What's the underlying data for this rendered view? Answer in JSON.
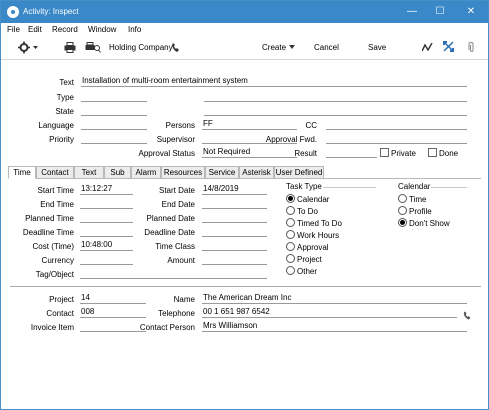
{
  "window": {
    "title": "Activity: Inspect",
    "minimize": "—",
    "maximize": "☐",
    "close": "✕"
  },
  "menu": [
    "File",
    "Edit",
    "Record",
    "Window",
    "Info"
  ],
  "toolbar": {
    "company": "Holding Company",
    "create": "Create",
    "cancel": "Cancel",
    "save": "Save"
  },
  "header": {
    "text_label": "Text",
    "text_value": "Installation of multi-room entertainment system",
    "type_label": "Type",
    "state_label": "State",
    "language_label": "Language",
    "persons_label": "Persons",
    "persons_value": "FF",
    "cc_label": "CC",
    "priority_label": "Priority",
    "supervisor_label": "Supervisor",
    "approval_fwd_label": "Approval Fwd.",
    "approval_status_label": "Approval Status",
    "approval_status_value": "Not Required",
    "result_label": "Result",
    "private_label": "Private",
    "done_label": "Done"
  },
  "tabs": [
    "Time",
    "Contact",
    "Text",
    "Sub",
    "Alarm",
    "Resources",
    "Service",
    "Asterisk",
    "User Defined"
  ],
  "time": {
    "start_time_label": "Start Time",
    "start_time": "13:12:27",
    "end_time_label": "End Time",
    "planned_time_label": "Planned Time",
    "deadline_time_label": "Deadline Time",
    "cost_time_label": "Cost (Time)",
    "cost_time": "10:48:00",
    "currency_label": "Currency",
    "tag_label": "Tag/Object",
    "start_date_label": "Start Date",
    "start_date": "14/8/2019",
    "end_date_label": "End Date",
    "planned_date_label": "Planned Date",
    "deadline_date_label": "Deadline Date",
    "time_class_label": "Time Class",
    "amount_label": "Amount"
  },
  "task_type": {
    "label": "Task Type",
    "options": [
      "Calendar",
      "To Do",
      "Timed To Do",
      "Work Hours",
      "Approval",
      "Project",
      "Other"
    ],
    "selected": 0
  },
  "calendar": {
    "label": "Calendar",
    "options": [
      "Time",
      "Profile",
      "Don't Show"
    ],
    "selected": 2
  },
  "footer": {
    "project_label": "Project",
    "project": "14",
    "contact_label": "Contact",
    "contact": "008",
    "invoice_label": "Invoice Item",
    "name_label": "Name",
    "name": "The American Dream Inc",
    "telephone_label": "Telephone",
    "telephone": "00 1 651 987 6542",
    "contact_person_label": "Contact Person",
    "contact_person": "Mrs Williamson"
  }
}
